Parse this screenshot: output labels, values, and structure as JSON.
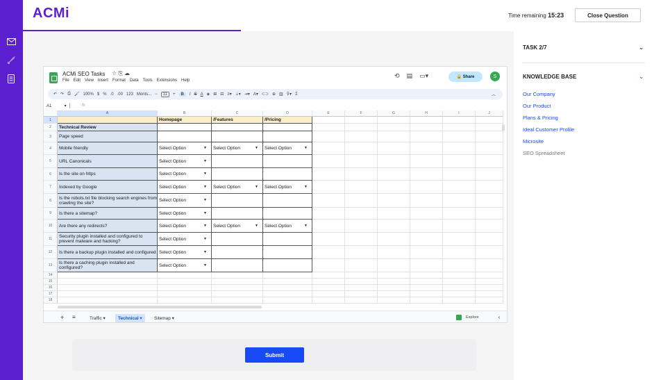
{
  "brand": {
    "logo": "ACMi",
    "accent": "#5b1fd0",
    "button_blue": "#1749f5"
  },
  "header": {
    "time_label": "Time remaining",
    "time_value": "15:23",
    "close_button": "Close Question"
  },
  "rail": {
    "icons": [
      "mail-icon",
      "rocket-icon",
      "document-icon"
    ]
  },
  "spreadsheet": {
    "title": "ACMi SEO Tasks",
    "menus": [
      "File",
      "Edit",
      "View",
      "Insert",
      "Format",
      "Data",
      "Tools",
      "Extensions",
      "Help"
    ],
    "share_label": "Share",
    "avatar_initial": "S",
    "toolbar": {
      "zoom": "100%",
      "currency": "$",
      "percent": "%",
      "dec_dec": ".0",
      "dec_inc": ".00",
      "num_fmt": "123",
      "font": "Monts...",
      "font_size": "11"
    },
    "name_box": "A1",
    "fx": "fx",
    "columns": [
      "A",
      "B",
      "C",
      "D",
      "E",
      "F",
      "G",
      "H",
      "I",
      "J"
    ],
    "header_row": [
      "",
      "Homepage",
      "/Features",
      "/Pricing"
    ],
    "rows": [
      {
        "num": "2",
        "label": "Technical Review",
        "bold": true,
        "b": "",
        "c": "",
        "d": ""
      },
      {
        "num": "3",
        "label": "Page speed",
        "b": "",
        "c": "",
        "d": ""
      },
      {
        "num": "4",
        "label": "Mobile friendly",
        "b": "Select Option",
        "c": "Select Option",
        "d": "Select Option"
      },
      {
        "num": "5",
        "label": "URL Canonicals",
        "b": "Select Option",
        "c": "",
        "d": ""
      },
      {
        "num": "6",
        "label": "Is the site on https",
        "b": "Select Option",
        "c": "",
        "d": ""
      },
      {
        "num": "7",
        "label": "Indexed by Google",
        "b": "Select Option",
        "c": "Select Option",
        "d": "Select Option"
      },
      {
        "num": "8",
        "label": "Is the robots.txt file blocking search engines from crawling the site?",
        "b": "Select Option",
        "c": "",
        "d": ""
      },
      {
        "num": "9",
        "label": "Is there a sitemap?",
        "b": "Select Option",
        "c": "",
        "d": ""
      },
      {
        "num": "10",
        "label": "Are there any redirects?",
        "b": "Select Option",
        "c": "Select Option",
        "d": "Select Option"
      },
      {
        "num": "11",
        "label": "Security plugin installed and configured to prevent malware and hacking?",
        "b": "Select Option",
        "c": "",
        "d": ""
      },
      {
        "num": "12",
        "label": "Is there a backup plugin installed and configured",
        "b": "Select Option",
        "c": "",
        "d": ""
      },
      {
        "num": "13",
        "label": "Is there a caching plugin installed and configured?",
        "b": "Select Option",
        "c": "",
        "d": ""
      }
    ],
    "empty_rows": [
      "14",
      "15",
      "16",
      "17",
      "18"
    ],
    "tabs": [
      {
        "label": "Traffic",
        "active": false
      },
      {
        "label": "Technical",
        "active": true
      },
      {
        "label": "Sitemap",
        "active": false
      }
    ],
    "explore_label": "Explore"
  },
  "submit_label": "Submit",
  "right_panel": {
    "task_label": "TASK 2/7",
    "kb_label": "KNOWLEDGE BASE",
    "kb_items": [
      {
        "label": "Our Company",
        "muted": false
      },
      {
        "label": "Our Product",
        "muted": false
      },
      {
        "label": "Plans & Pricing",
        "muted": false
      },
      {
        "label": "Ideal Customer Profile",
        "muted": false
      },
      {
        "label": "Microsite",
        "muted": false
      },
      {
        "label": "SEO Spreadsheet",
        "muted": true
      }
    ]
  }
}
